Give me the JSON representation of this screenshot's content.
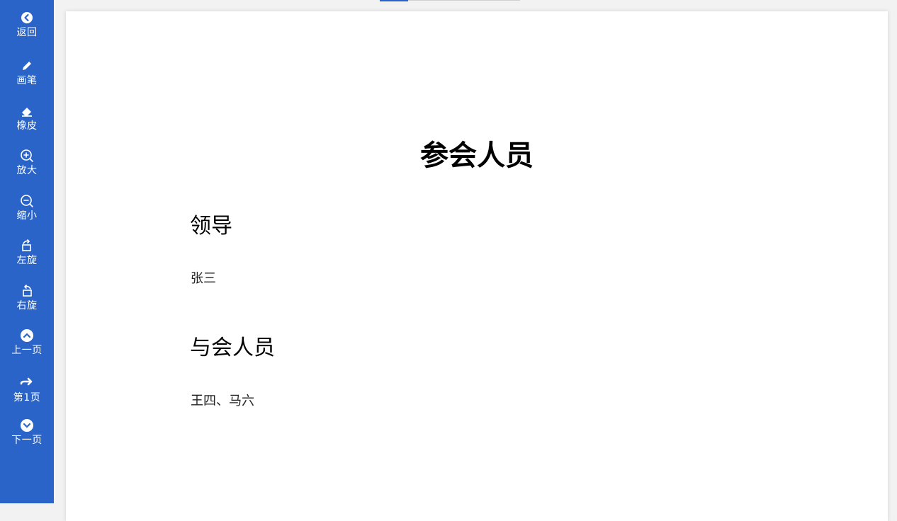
{
  "toolbar": {
    "back": {
      "label": "返回",
      "icon": "chevron-left-circle-icon"
    },
    "pen": {
      "label": "画笔",
      "icon": "pencil-icon"
    },
    "eraser": {
      "label": "橡皮",
      "icon": "eraser-icon"
    },
    "zoom_in": {
      "label": "放大",
      "icon": "zoom-in-icon"
    },
    "zoom_out": {
      "label": "缩小",
      "icon": "zoom-out-icon"
    },
    "rotate_left": {
      "label": "左旋",
      "icon": "rotate-left-icon"
    },
    "rotate_right": {
      "label": "右旋",
      "icon": "rotate-right-icon"
    },
    "prev_page": {
      "label": "上一页",
      "icon": "chevron-up-circle-icon"
    },
    "page_indicator": {
      "label": "第1页",
      "icon": "arrow-right-icon"
    },
    "next_page": {
      "label": "下一页",
      "icon": "chevron-down-circle-icon"
    }
  },
  "progress": {
    "fraction": 0.2
  },
  "document": {
    "title": "参会人员",
    "sections": [
      {
        "heading": "领导",
        "body": "张三"
      },
      {
        "heading": "与会人员",
        "body": "王四、马六"
      }
    ]
  },
  "colors": {
    "sidebar": "#2b64c9",
    "page": "#ffffff",
    "background": "#f2f2f2"
  }
}
